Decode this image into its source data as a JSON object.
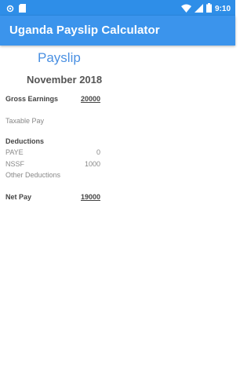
{
  "status_bar": {
    "time": "9:10",
    "icons_left": [
      "settings-icon",
      "sd-card-icon"
    ],
    "icons_right": [
      "wifi-icon",
      "signal-icon",
      "battery-icon"
    ]
  },
  "app_bar": {
    "title": "Uganda Payslip Calculator",
    "color": "#3b94ec"
  },
  "payslip": {
    "title": "Payslip",
    "month": "November 2018",
    "gross_earnings": {
      "label": "Gross Earnings",
      "value": "20000"
    },
    "taxable_pay": {
      "label": "Taxable Pay",
      "value": ""
    },
    "deductions": {
      "heading": "Deductions",
      "items": [
        {
          "label": "PAYE",
          "value": "0"
        },
        {
          "label": "NSSF",
          "value": "1000"
        },
        {
          "label": "Other Deductions",
          "value": ""
        }
      ]
    },
    "net_pay": {
      "label": "Net Pay",
      "value": "19000"
    }
  }
}
